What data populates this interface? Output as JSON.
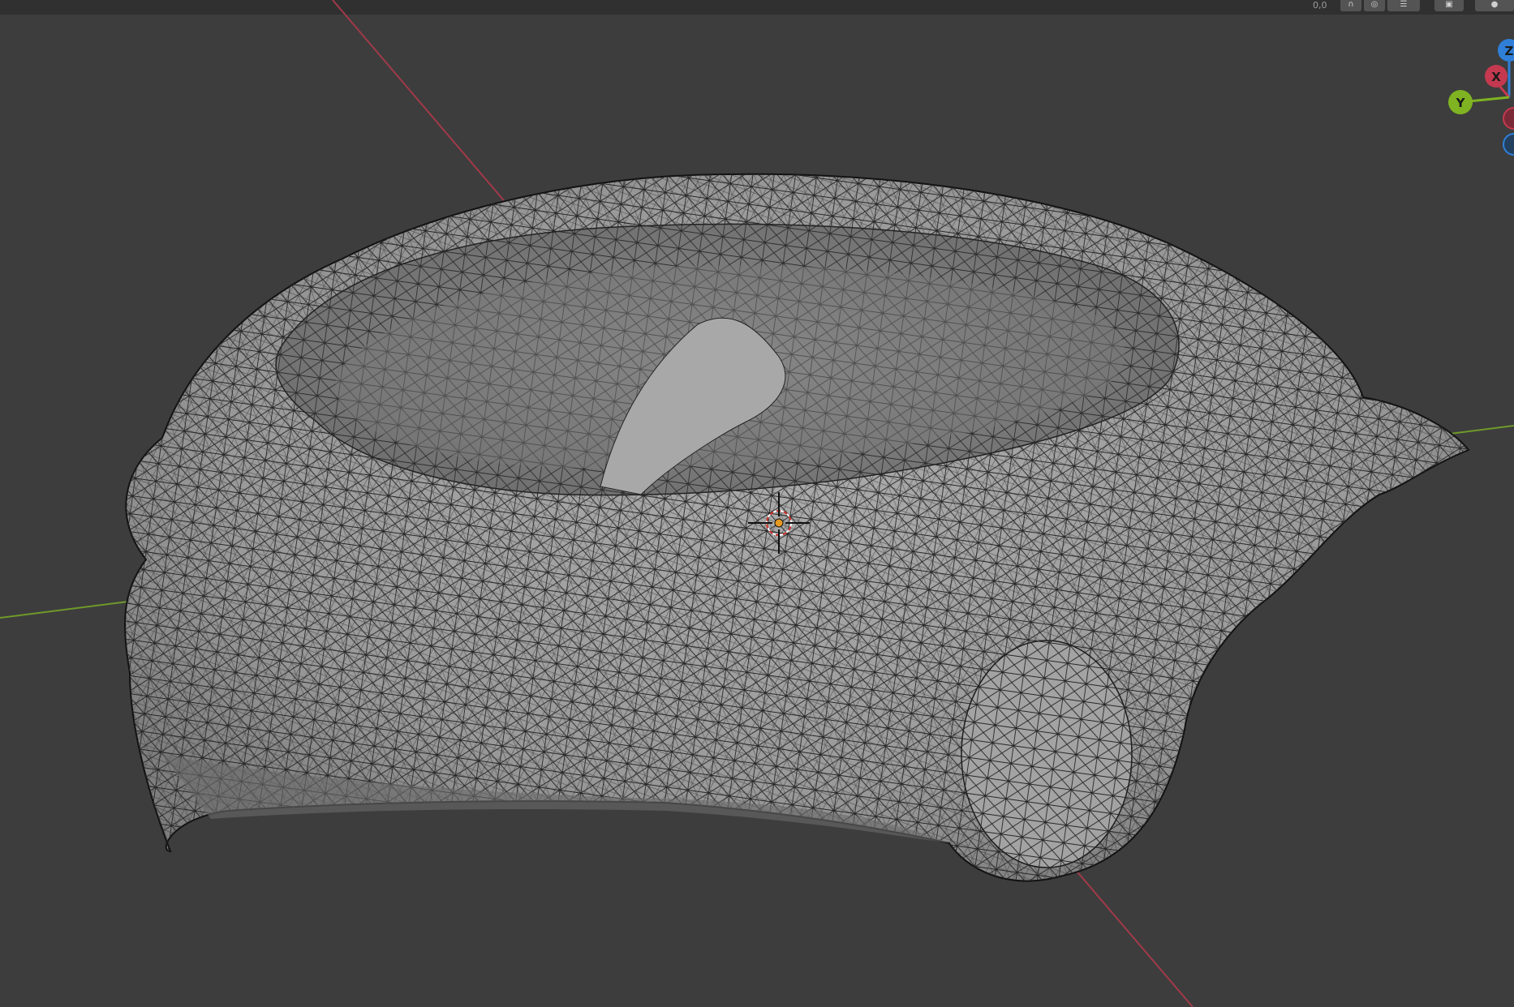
{
  "app": {
    "name": "Blender 3D Viewport"
  },
  "header": {
    "coords_readout": "0,0",
    "buttons": [
      {
        "name": "snap-toggle-button",
        "icon": "magnet-icon"
      },
      {
        "name": "proportional-edit-button",
        "icon": "circle-dot-icon"
      },
      {
        "name": "overlay-button",
        "icon": "overlay-icon"
      },
      {
        "name": "xray-button",
        "icon": "xray-icon"
      },
      {
        "name": "shading-button",
        "icon": "sphere-icon"
      }
    ]
  },
  "gizmo": {
    "z_label": "Z",
    "x_label": "X",
    "y_label": "Y",
    "colors": {
      "x": "#c4394f",
      "y": "#7fb321",
      "z": "#2f7fd8"
    }
  },
  "scene": {
    "object": "scanned mesh (wireframe on solid)",
    "colors": {
      "mesh_fill": "#9a9a9a",
      "wire": "#1f1f1f",
      "background": "#3d3d3d",
      "x_axis": "#a13a49",
      "y_axis": "#6f9a2a"
    }
  }
}
